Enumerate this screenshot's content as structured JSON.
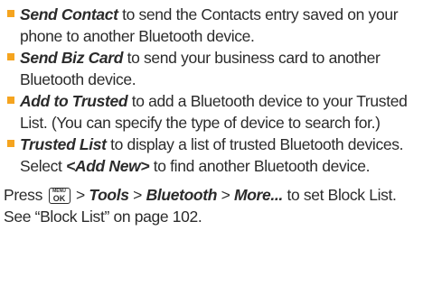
{
  "bullets": [
    {
      "term": "Send Contact",
      "text": " to send the Contacts entry saved on your phone to another Bluetooth device."
    },
    {
      "term": "Send Biz Card",
      "text": " to send your business card to another Bluetooth device."
    },
    {
      "term": "Add to Trusted",
      "text": " to add a Bluetooth device to your Trusted List. (You can specify the type of device to search for.)"
    },
    {
      "term": "Trusted List",
      "text": " to display a list of trusted Bluetooth devices. Select ",
      "term2": "<Add New>",
      "text2": " to find another Bluetooth device."
    }
  ],
  "para": {
    "press": "Press ",
    "key_top": "MENU",
    "key_bottom": "OK",
    "sep": " > ",
    "path1": "Tools",
    "path2": "Bluetooth",
    "path3": "More...",
    "rest": " to set Block List. See “Block List” on page 102."
  },
  "colors": {
    "bullet": "#f5a41f",
    "text": "#2b2b2b"
  }
}
